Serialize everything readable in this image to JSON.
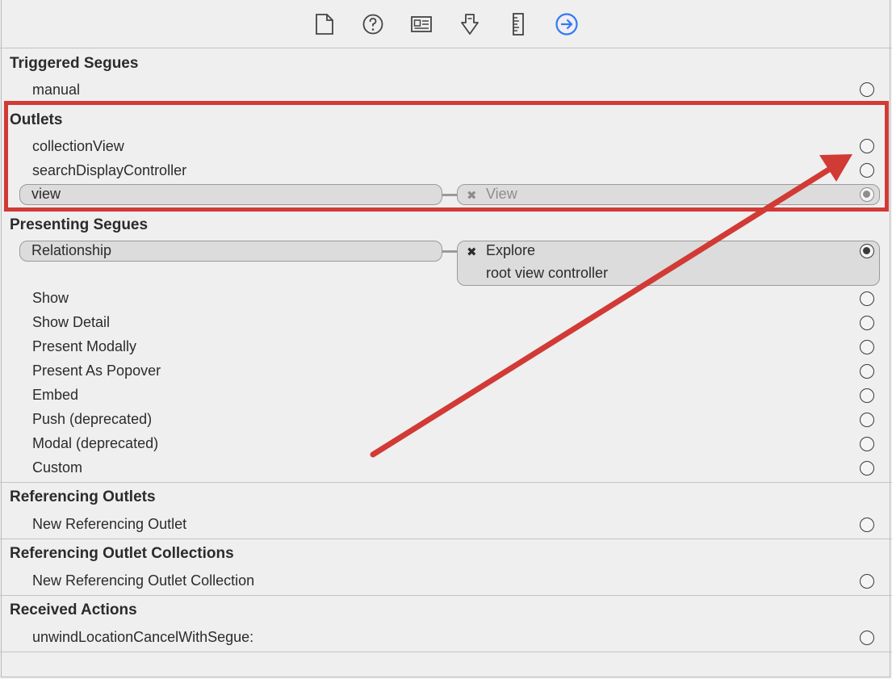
{
  "toolbar": {
    "icons": [
      "file-inspector-icon",
      "quick-help-icon",
      "identity-inspector-icon",
      "attributes-inspector-icon",
      "size-inspector-icon",
      "connections-inspector-icon"
    ],
    "active_color": "#3478f6"
  },
  "triggered_segues": {
    "title": "Triggered Segues",
    "items": [
      {
        "label": "manual",
        "connected": false
      }
    ]
  },
  "outlets": {
    "title": "Outlets",
    "items": [
      {
        "label": "collectionView",
        "connected": false
      },
      {
        "label": "searchDisplayController",
        "connected": false
      },
      {
        "label": "view",
        "connected": true,
        "target": "View"
      }
    ]
  },
  "presenting_segues": {
    "title": "Presenting Segues",
    "relationship": {
      "label": "Relationship",
      "target_line1": "Explore",
      "target_line2": "root view controller",
      "connected": true
    },
    "items": [
      {
        "label": "Show"
      },
      {
        "label": "Show Detail"
      },
      {
        "label": "Present Modally"
      },
      {
        "label": "Present As Popover"
      },
      {
        "label": "Embed"
      },
      {
        "label": "Push (deprecated)"
      },
      {
        "label": "Modal (deprecated)"
      },
      {
        "label": "Custom"
      }
    ]
  },
  "referencing_outlets": {
    "title": "Referencing Outlets",
    "items": [
      {
        "label": "New Referencing Outlet"
      }
    ]
  },
  "referencing_outlet_collections": {
    "title": "Referencing Outlet Collections",
    "items": [
      {
        "label": "New Referencing Outlet Collection"
      }
    ]
  },
  "received_actions": {
    "title": "Received Actions",
    "items": [
      {
        "label": "unwindLocationCancelWithSegue:"
      }
    ]
  },
  "annotation": {
    "highlight_color": "#d13a35"
  },
  "glyphs": {
    "remove": "✖"
  }
}
